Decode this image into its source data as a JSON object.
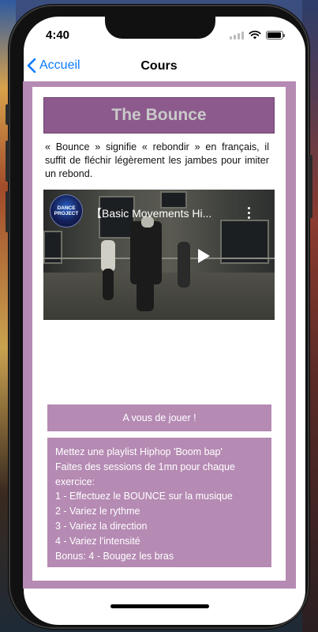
{
  "status_bar": {
    "time": "4:40"
  },
  "nav": {
    "back_label": "Accueil",
    "title": "Cours"
  },
  "lesson": {
    "title": "The Bounce",
    "description": "« Bounce » signifie « rebondir » en français, il suffit de fléchir légèrement les jambes pour imiter un rebond."
  },
  "video": {
    "title": "【Basic Movements Hi...",
    "channel_logo_text_1": "DANCE",
    "channel_logo_text_2": "PROJECT"
  },
  "cta": {
    "label": "A vous de jouer !"
  },
  "instructions": {
    "lines": [
      "Mettez une playlist Hiphop 'Boom bap'",
      "Faites des sessions de 1mn pour chaque",
      "exercice:",
      "1 - Effectuez le BOUNCE sur la musique",
      "2 - Variez le rythme",
      "3 - Variez la direction",
      "4 - Variez l'intensité",
      "Bonus: 4 - Bougez les bras"
    ]
  },
  "colors": {
    "accent": "#0a7aff",
    "lesson_purple": "#b58ab3",
    "title_purple": "#8c5a8c"
  },
  "icons": {
    "back": "chevron-left-icon",
    "wifi": "wifi-icon",
    "battery": "battery-icon",
    "signal": "cellular-signal-icon",
    "play": "play-icon",
    "more": "more-vertical-icon"
  }
}
